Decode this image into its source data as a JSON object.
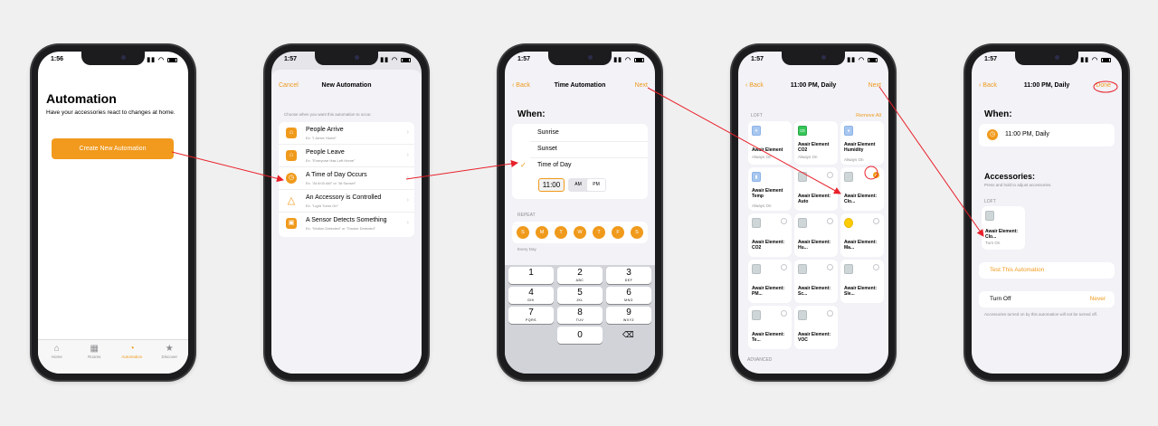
{
  "colors": {
    "accent": "#f09a1c",
    "annotation": "#e8202a",
    "phone_frame": "#1c1c1e"
  },
  "phone1": {
    "time": "1:56",
    "title": "Automation",
    "description": "Have your accessories react to changes at home.",
    "create_button": "Create New Automation",
    "tabs": [
      {
        "label": "Home",
        "icon": "house-icon"
      },
      {
        "label": "Rooms",
        "icon": "rooms-icon"
      },
      {
        "label": "Automation",
        "icon": "automation-clock-icon"
      },
      {
        "label": "Discover",
        "icon": "star-icon"
      }
    ]
  },
  "phone2": {
    "time": "1:57",
    "nav": {
      "left": "Cancel",
      "title": "New Automation"
    },
    "instruction": "Choose when you want this automation to occur.",
    "options": [
      {
        "title": "People Arrive",
        "subtitle": "Ex. \"I Arrive Home\"",
        "icon": "person-arrive-icon"
      },
      {
        "title": "People Leave",
        "subtitle": "Ex. \"Everyone Has Left Home\"",
        "icon": "person-leave-icon"
      },
      {
        "title": "A Time of Day Occurs",
        "subtitle": "Ex. \"At 8:00 AM\" or \"At Sunset\"",
        "icon": "clock-icon"
      },
      {
        "title": "An Accessory is Controlled",
        "subtitle": "Ex. \"Light Turns On\"",
        "icon": "accessory-icon"
      },
      {
        "title": "A Sensor Detects Something",
        "subtitle": "Ex. \"Motion Detected\" or \"Smoke Detected\"",
        "icon": "sensor-icon"
      }
    ]
  },
  "phone3": {
    "time": "1:57",
    "nav": {
      "left": "Back",
      "title": "Time Automation",
      "right": "Next"
    },
    "when_label": "When:",
    "options": [
      "Sunrise",
      "Sunset",
      "Time of Day"
    ],
    "time_value": "11:00",
    "am": "AM",
    "pm": "PM",
    "repeat_label": "REPEAT",
    "days": [
      "S",
      "M",
      "T",
      "W",
      "T",
      "F",
      "S"
    ],
    "repeat_summary": "Every Day",
    "keypad": [
      {
        "digit": "1",
        "letters": ""
      },
      {
        "digit": "2",
        "letters": "ABC"
      },
      {
        "digit": "3",
        "letters": "DEF"
      },
      {
        "digit": "4",
        "letters": "GHI"
      },
      {
        "digit": "5",
        "letters": "JKL"
      },
      {
        "digit": "6",
        "letters": "MNO"
      },
      {
        "digit": "7",
        "letters": "PQRS"
      },
      {
        "digit": "8",
        "letters": "TUV"
      },
      {
        "digit": "9",
        "letters": "WXYZ"
      },
      {
        "digit": "0",
        "letters": ""
      }
    ]
  },
  "phone4": {
    "time": "1:57",
    "nav": {
      "left": "Back",
      "title": "11:00 PM, Daily",
      "right": "Next"
    },
    "section": "LOFT",
    "remove_all": "Remove All",
    "footer": "ADVANCED",
    "tiles": [
      {
        "name": "Awair Element",
        "status": "Always On",
        "icon": "blue",
        "selected": null
      },
      {
        "name": "Awair Element CO2",
        "status": "Always On",
        "icon": "green",
        "selected": null
      },
      {
        "name": "Awair Element Humidity",
        "status": "Always On",
        "icon": "blue",
        "selected": null
      },
      {
        "name": "Awair Element Temp",
        "status": "Always On",
        "icon": "blue",
        "selected": null
      },
      {
        "name": "Awair Element: Auto",
        "status": "",
        "icon": "gray",
        "selected": false
      },
      {
        "name": "Awair Element: Clo...",
        "status": "",
        "icon": "gray",
        "selected": true
      },
      {
        "name": "Awair Element: CO2",
        "status": "",
        "icon": "gray",
        "selected": false
      },
      {
        "name": "Awair Element: Hu...",
        "status": "",
        "icon": "gray",
        "selected": false
      },
      {
        "name": "Awair Element: Ma...",
        "status": "",
        "icon": "yellow",
        "selected": false
      },
      {
        "name": "Awair Element: PM...",
        "status": "",
        "icon": "gray",
        "selected": false
      },
      {
        "name": "Awair Element: Sc...",
        "status": "",
        "icon": "gray",
        "selected": false
      },
      {
        "name": "Awair Element: Sle...",
        "status": "",
        "icon": "gray",
        "selected": false
      },
      {
        "name": "Awair Element: Te...",
        "status": "",
        "icon": "gray",
        "selected": false
      },
      {
        "name": "Awair Element: VOC",
        "status": "",
        "icon": "gray",
        "selected": false
      }
    ]
  },
  "phone5": {
    "time": "1:57",
    "nav": {
      "left": "Back",
      "title": "11:00 PM, Daily",
      "right": "Done"
    },
    "when_label": "When:",
    "when_value": "11:00 PM, Daily",
    "accessories_label": "Accessories:",
    "accessories_hint": "Press and hold to adjust accessories.",
    "section": "LOFT",
    "tile": {
      "name": "Awair Element: Clo...",
      "status": "Turn On"
    },
    "test_button": "Test This Automation",
    "turn_off_label": "Turn Off",
    "turn_off_value": "Never",
    "turn_off_note": "Accessories turned on by this automation will not be turned off."
  }
}
